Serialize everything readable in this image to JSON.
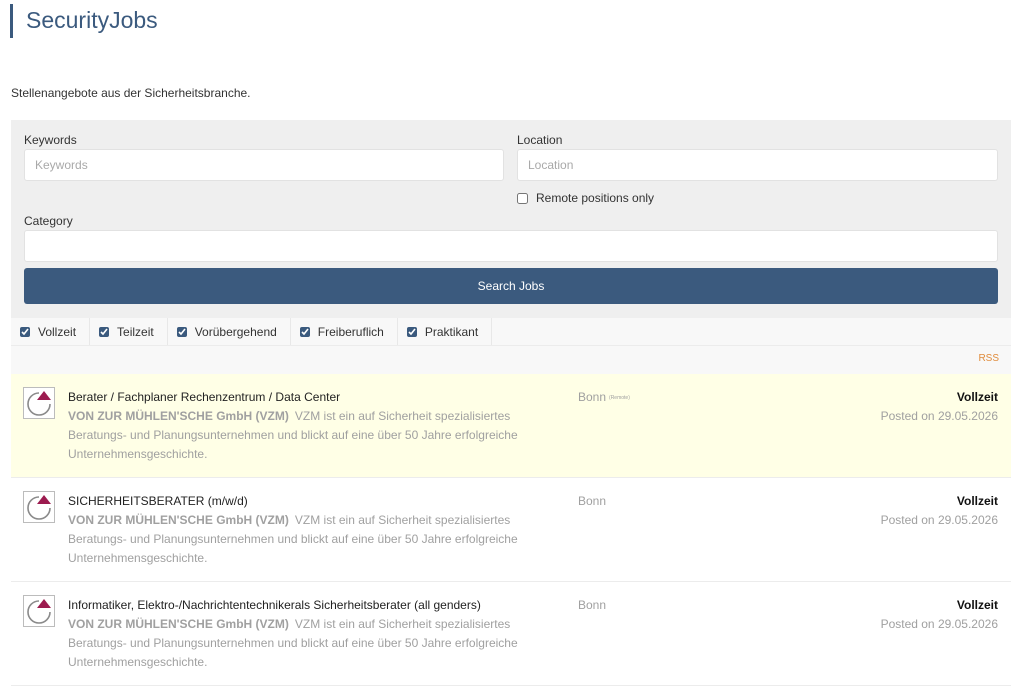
{
  "site": {
    "title": "SecurityJobs",
    "intro": "Stellenangebote aus der Sicherheitsbranche."
  },
  "search": {
    "keywords_label": "Keywords",
    "keywords_placeholder": "Keywords",
    "keywords_value": "",
    "location_label": "Location",
    "location_placeholder": "Location",
    "location_value": "",
    "remote_label": "Remote positions only",
    "remote_checked": false,
    "category_label": "Category",
    "category_value": "",
    "button_label": "Search Jobs"
  },
  "job_types": [
    {
      "label": "Vollzeit",
      "checked": true
    },
    {
      "label": "Teilzeit",
      "checked": true
    },
    {
      "label": "Vorübergehend",
      "checked": true
    },
    {
      "label": "Freiberuflich",
      "checked": true
    },
    {
      "label": "Praktikant",
      "checked": true
    }
  ],
  "rss_label": "RSS",
  "colors": {
    "brand": "#3b5a7e",
    "featured_background": "#ffffe6",
    "rss": "#e08c3c",
    "logo_accent": "#9c1b4f"
  },
  "jobs": [
    {
      "title": "Berater / Fachplaner Rechenzentrum / Data Center",
      "company": "VON ZUR MÜHLEN'SCHE GmbH (VZM)",
      "tagline": "VZM ist ein auf Sicherheit spezialisiertes Beratungs- und Planungsunternehmen und blickt auf eine über 50 Jahre erfolgreiche Unternehmensgeschichte.",
      "location": "Bonn",
      "remote_tag": "(Remote)",
      "type": "Vollzeit",
      "posted": "Posted on 29.05.2026",
      "featured": true,
      "logo_icon": "vzm-logo-icon"
    },
    {
      "title": "SICHERHEITSBERATER (m/w/d)",
      "company": "VON ZUR MÜHLEN'SCHE GmbH (VZM)",
      "tagline": "VZM ist ein auf Sicherheit spezialisiertes Beratungs- und Planungsunternehmen und blickt auf eine über 50 Jahre erfolgreiche Unternehmensgeschichte.",
      "location": "Bonn",
      "remote_tag": "",
      "type": "Vollzeit",
      "posted": "Posted on 29.05.2026",
      "featured": false,
      "logo_icon": "vzm-logo-icon"
    },
    {
      "title": "Informatiker, Elektro-/Nachrichtentechnikerals Sicherheitsberater (all genders)",
      "company": "VON ZUR MÜHLEN'SCHE GmbH (VZM)",
      "tagline": "VZM ist ein auf Sicherheit spezialisiertes Beratungs- und Planungsunternehmen und blickt auf eine über 50 Jahre erfolgreiche Unternehmensgeschichte.",
      "location": "Bonn",
      "remote_tag": "",
      "type": "Vollzeit",
      "posted": "Posted on 29.05.2026",
      "featured": false,
      "logo_icon": "vzm-logo-icon"
    }
  ]
}
